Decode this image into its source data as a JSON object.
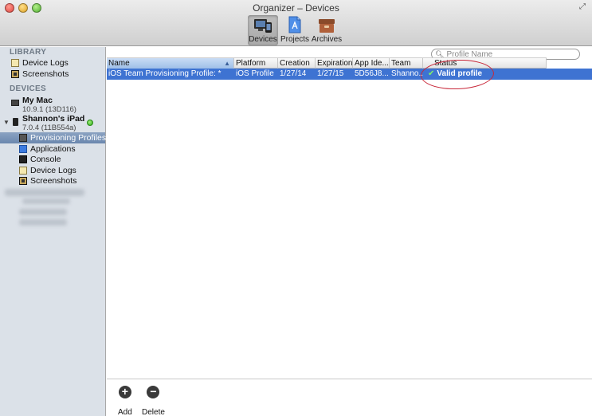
{
  "window": {
    "title": "Organizer – Devices"
  },
  "toolbar": {
    "items": [
      {
        "label": "Devices",
        "icon": "devices-icon",
        "active": true
      },
      {
        "label": "Projects",
        "icon": "projects-icon",
        "active": false
      },
      {
        "label": "Archives",
        "icon": "archives-icon",
        "active": false
      }
    ]
  },
  "sidebar": {
    "library_header": "LIBRARY",
    "library_items": [
      "Device Logs",
      "Screenshots"
    ],
    "devices_header": "DEVICES",
    "mac": {
      "name": "My Mac",
      "version": "10.9.1 (13D116)"
    },
    "ipad": {
      "name": "Shannon's iPad",
      "version": "7.0.4 (11B554a)",
      "status_color": "#2ea81c",
      "items": [
        "Provisioning Profiles",
        "Applications",
        "Console",
        "Device Logs",
        "Screenshots"
      ],
      "selected": "Provisioning Profiles"
    }
  },
  "search": {
    "placeholder": "Profile Name",
    "value": ""
  },
  "table": {
    "columns": [
      "Name",
      "Platform",
      "Creation",
      "Expiration",
      "App Ide...",
      "Team",
      "Status"
    ],
    "sorted_column": "Name",
    "rows": [
      {
        "name": "iOS Team Provisioning Profile: *",
        "platform": "iOS Profile",
        "creation": "1/27/14",
        "expiration": "1/27/15",
        "app_id": "5D56J8...",
        "team": "Shanno...",
        "status": "Valid profile"
      }
    ],
    "selection_color": "#3e73d2"
  },
  "bottom": {
    "add_label": "Add",
    "delete_label": "Delete"
  },
  "annotation_color": "#c8283a"
}
